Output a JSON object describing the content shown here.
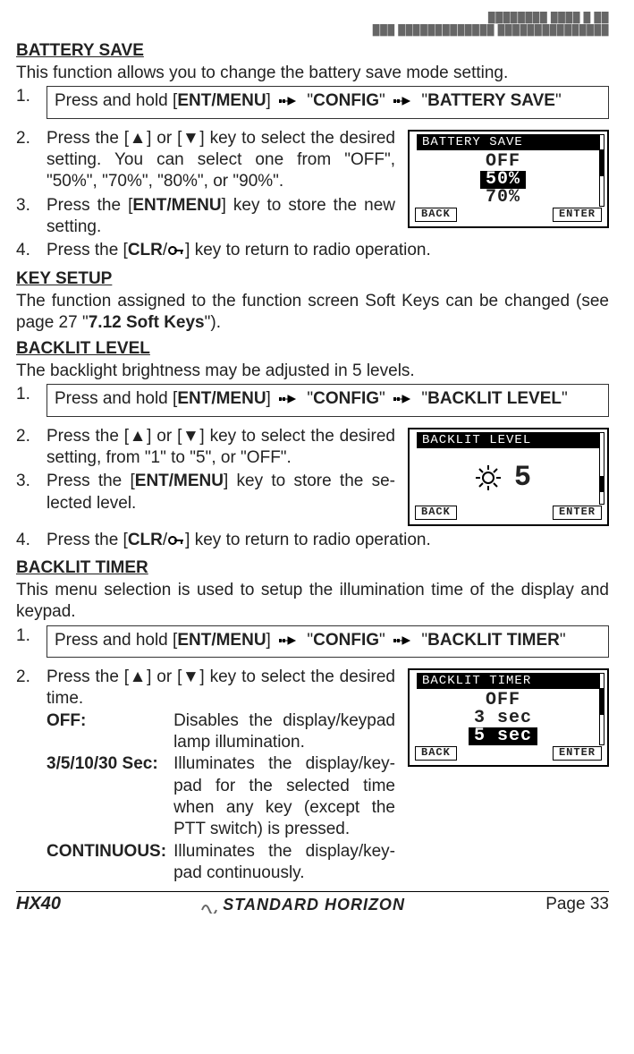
{
  "header": {
    "line1": "████████ ████ █ ██",
    "line2": "███ █████████████ ███████████████"
  },
  "icons": {
    "arrow": "→",
    "key": "⌁"
  },
  "battery_save": {
    "title": "BATTERY SAVE",
    "intro": "This function allows you to change the battery save mode setting.",
    "step1": {
      "num": "1.",
      "prefix": "Press and hold [",
      "key": "ENT/MENU",
      "mid1": "] ",
      "q1": "\"",
      "config": "CONFIG",
      "q2": "\"",
      "q3": "\"",
      "target": "BATTERY SAVE",
      "q4": "\""
    },
    "step2": {
      "num": "2.",
      "text_a": "Press the [▲] or [▼] key to select the de­sired setting. You can select one from \"OFF\", \"50%\", \"70%\", \"80%\", or \"90%\"."
    },
    "step3": {
      "num": "3.",
      "text": "Press the [",
      "key": "ENT/MENU",
      "text2": "] key to store the new setting."
    },
    "step4": {
      "num": "4.",
      "text": "Press the [",
      "key": "CLR",
      "slash": "/",
      "text2": "] key to return to radio operation."
    },
    "lcd": {
      "title": "BATTERY SAVE",
      "opt1": "OFF",
      "opt2": "50%",
      "opt3": "70%",
      "sk_back": "BACK",
      "sk_enter": "ENTER"
    }
  },
  "key_setup": {
    "title": "KEY SETUP",
    "text_a": "The function assigned to the function screen Soft Keys can be changed (see page 27 \"",
    "bold": "7.12 Soft Keys",
    "text_b": "\")."
  },
  "backlit_level": {
    "title": "BACKLIT LEVEL",
    "intro": "The backlight brightness may be adjusted in 5 levels.",
    "step1": {
      "num": "1.",
      "prefix": "Press and hold [",
      "key": "ENT/MENU",
      "mid1": "] ",
      "q1": "\"",
      "config": "CONFIG",
      "q2": "\"",
      "q3": "\"",
      "target": "BACKLIT LEVEL",
      "q4": "\""
    },
    "step2": {
      "num": "2.",
      "text": "Press the [▲] or [▼] key to select the de­sired setting, from \"1\" to \"5\", or \"OFF\"."
    },
    "step3": {
      "num": "3.",
      "text": "Press the [",
      "key": "ENT/MENU",
      "text2": "] key to store the se­lected level."
    },
    "step4": {
      "num": "4.",
      "text": "Press the [",
      "key": "CLR",
      "slash": "/",
      "text2": "] key to return to radio operation."
    },
    "lcd": {
      "title": "BACKLIT LEVEL",
      "value": "5",
      "sk_back": "BACK",
      "sk_enter": "ENTER"
    }
  },
  "backlit_timer": {
    "title": "BACKLIT TIMER",
    "intro": "This menu selection is used to setup the illumination time of the display and keypad.",
    "step1": {
      "num": "1.",
      "prefix": "Press and hold [",
      "key": "ENT/MENU",
      "mid1": "] ",
      "q1": "\"",
      "config": "CONFIG",
      "q2": "\"",
      "q3": "\"",
      "target": "BACKLIT TIMER",
      "q4": "\""
    },
    "step2": {
      "num": "2.",
      "text": "Press the [▲] or [▼] key to select the de­sired time."
    },
    "opts": {
      "off_k": "OFF",
      "off_v": ":",
      "off_d": "Disables the display/key­pad lamp illumination.",
      "sec_k": "3/5/10/30 Sec",
      "sec_v": ":",
      "sec_d": "Illuminates the display/key­pad for the selected time when any key (except the PTT switch) is pressed.",
      "cont_k": "CONTINUOUS",
      "cont_v": ":",
      "cont_d": "Illuminates the display/key­pad continuously."
    },
    "lcd": {
      "title": "BACKLIT TIMER",
      "opt1": "OFF",
      "opt2": "3 sec",
      "opt3": "5 sec",
      "sk_back": "BACK",
      "sk_enter": "ENTER"
    }
  },
  "footer": {
    "model": "HX40",
    "brand": "STANDARD HORIZON",
    "page": "Page 33"
  }
}
